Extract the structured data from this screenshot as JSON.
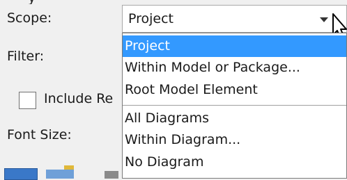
{
  "top_partial_text": "y",
  "scope": {
    "label": "Scope:",
    "value": "Project"
  },
  "filter": {
    "label": "Filter:"
  },
  "include_checkbox": {
    "label": "Include Re",
    "checked": false
  },
  "font_size": {
    "label": "Font Size:"
  },
  "dropdown": {
    "items": [
      {
        "label": "Project",
        "selected": true
      },
      {
        "label": "Within Model or Package...",
        "selected": false
      },
      {
        "label": "Root Model Element",
        "selected": false
      },
      {
        "label": "All Diagrams",
        "selected": false
      },
      {
        "label": "Within Diagram...",
        "selected": false
      },
      {
        "label": "No Diagram",
        "selected": false
      }
    ]
  },
  "colors": {
    "selection": "#3399ff",
    "background": "#f0f0f0"
  }
}
